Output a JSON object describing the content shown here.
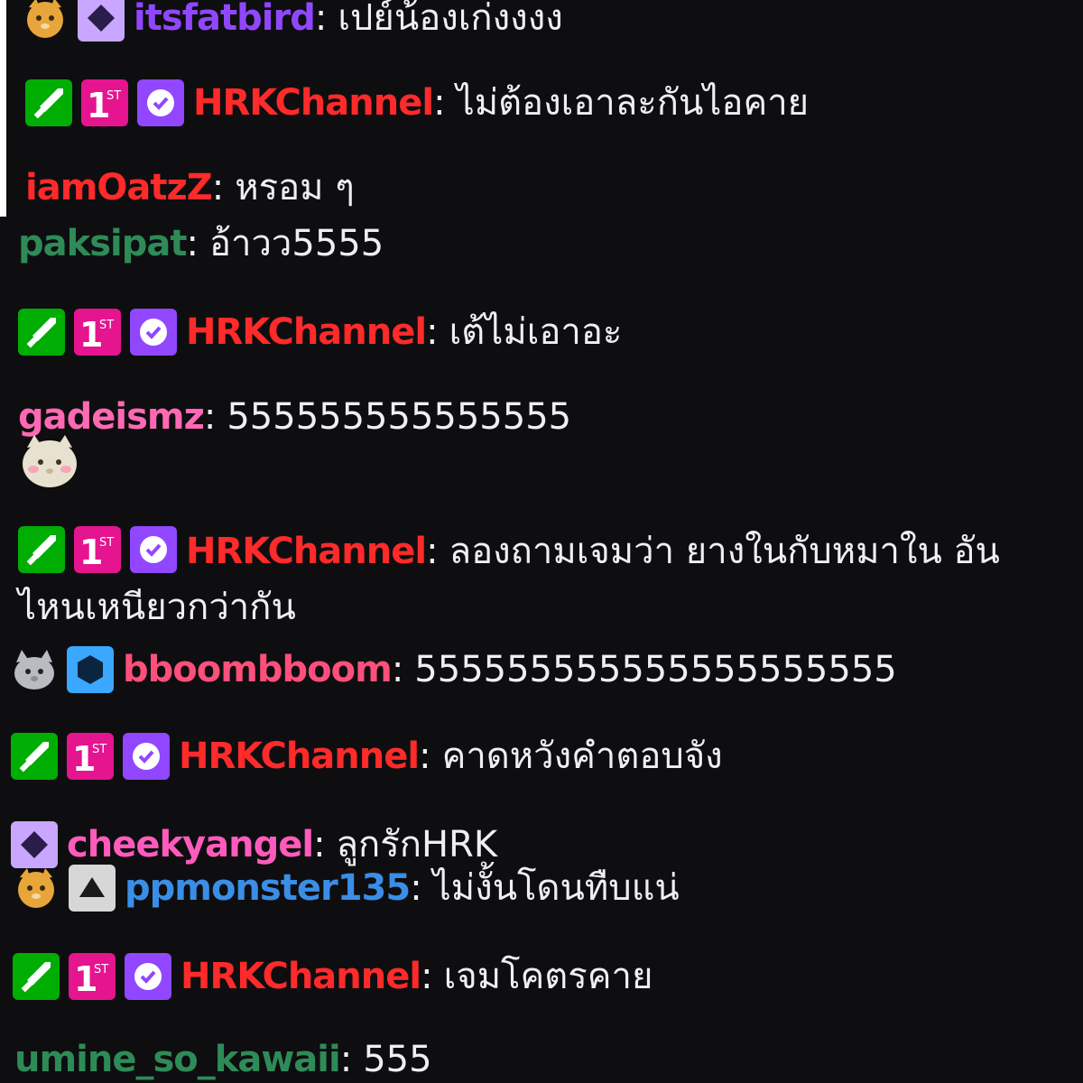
{
  "chat": {
    "messages": [
      {
        "id": "m1",
        "user": "itsfatbird",
        "color": "#9147ff",
        "text": "เปย์น้องเก่งงงง",
        "badges": [
          "cat-face",
          "prime"
        ]
      },
      {
        "id": "m2",
        "user": "HRKChannel",
        "color": "#ff2a2a",
        "text": "ไม่ต้องเอาละกันไอคาย",
        "badges": [
          "moderator-sword",
          "first-place",
          "verified"
        ]
      },
      {
        "id": "m3",
        "user": "iamOatzZ",
        "color": "#ff2a2a",
        "text": "หรอม ๆ",
        "badges": []
      },
      {
        "id": "m4",
        "user": "paksipat",
        "color": "#2e8b57",
        "text": "อ้าวว5555",
        "badges": []
      },
      {
        "id": "m5",
        "user": "HRKChannel",
        "color": "#ff2a2a",
        "text": "เต้ไม่เอาอะ",
        "badges": [
          "moderator-sword",
          "first-place",
          "verified"
        ]
      },
      {
        "id": "m6",
        "user": "gadeismz",
        "color": "#ff69b4",
        "text": "555555555555555",
        "badges": []
      },
      {
        "id": "m7",
        "user": "HRKChannel",
        "color": "#ff2a2a",
        "text": "ลองถามเจมว่า ยางในกับหมาใน อันไหนเหนียวกว่ากัน",
        "badges": [
          "moderator-sword",
          "first-place",
          "verified"
        ]
      },
      {
        "id": "m8",
        "user": "bboombboom",
        "color": "#ff4f7b",
        "text": "555555555555555555555",
        "badges": [
          "grey-cat-face",
          "sub-hexagon"
        ]
      },
      {
        "id": "m9",
        "user": "HRKChannel",
        "color": "#ff2a2a",
        "text": "คาดหวังคำตอบจัง",
        "badges": [
          "moderator-sword",
          "first-place",
          "verified"
        ]
      },
      {
        "id": "m10",
        "user": "cheekyangel",
        "color": "#ff5bbd",
        "text": "ลูกรักHRK",
        "badges": [
          "prime"
        ]
      },
      {
        "id": "m11",
        "user": "ppmonster135",
        "color": "#3a8ee6",
        "text": "ไม่งั้นโดนทืบแน่",
        "badges": [
          "cat-face",
          "sub-triangle"
        ]
      },
      {
        "id": "m12",
        "user": "HRKChannel",
        "color": "#ff2a2a",
        "text": "เจมโคตรคาย",
        "badges": [
          "moderator-sword",
          "first-place",
          "verified"
        ]
      },
      {
        "id": "m13",
        "user": "umine_so_kawaii",
        "color": "#2e8b57",
        "text": "555",
        "badges": []
      }
    ],
    "separator": ":",
    "emote_under_m6": "blushing-cat-emote"
  }
}
